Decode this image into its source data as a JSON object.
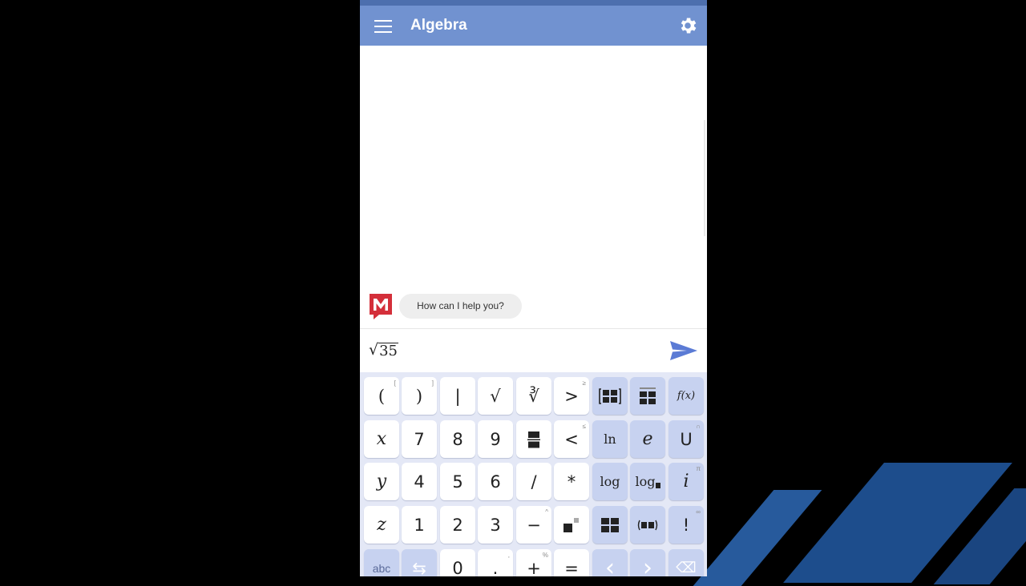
{
  "app": {
    "title": "Algebra"
  },
  "chat": {
    "bot_message": "How can I help you?",
    "bot_avatar_letter": "M"
  },
  "input": {
    "radical": "√",
    "radicand": "35"
  },
  "keyboard": {
    "rows": [
      [
        {
          "label": "(",
          "hint": "["
        },
        {
          "label": ")",
          "hint": "]"
        },
        {
          "label": "|",
          "hint": ""
        },
        {
          "label": "√",
          "hint": ""
        },
        {
          "label": "∛",
          "hint": ""
        },
        {
          "label": ">",
          "hint": "≥"
        },
        {
          "label": "matrix",
          "hint": ""
        },
        {
          "label": "system",
          "hint": ""
        },
        {
          "label": "f(x)",
          "hint": ""
        }
      ],
      [
        {
          "label": "x",
          "hint": ""
        },
        {
          "label": "7",
          "hint": ""
        },
        {
          "label": "8",
          "hint": ""
        },
        {
          "label": "9",
          "hint": ""
        },
        {
          "label": "fraction",
          "hint": ""
        },
        {
          "label": "<",
          "hint": "≤"
        },
        {
          "label": "ln",
          "hint": ""
        },
        {
          "label": "e",
          "hint": ""
        },
        {
          "label": "U",
          "hint": "∩"
        }
      ],
      [
        {
          "label": "y",
          "hint": ""
        },
        {
          "label": "4",
          "hint": ""
        },
        {
          "label": "5",
          "hint": ""
        },
        {
          "label": "6",
          "hint": ""
        },
        {
          "label": "/",
          "hint": ""
        },
        {
          "label": "*",
          "hint": ""
        },
        {
          "label": "log",
          "hint": ""
        },
        {
          "label": "log",
          "hint": ""
        },
        {
          "label": "i",
          "hint": "π"
        }
      ],
      [
        {
          "label": "z",
          "hint": ""
        },
        {
          "label": "1",
          "hint": ""
        },
        {
          "label": "2",
          "hint": ""
        },
        {
          "label": "3",
          "hint": ""
        },
        {
          "label": "−",
          "hint": "^"
        },
        {
          "label": "power",
          "hint": ""
        },
        {
          "label": "subscript",
          "hint": ""
        },
        {
          "label": "interval",
          "hint": ""
        },
        {
          "label": "!",
          "hint": "∞"
        }
      ],
      [
        {
          "label": "abc",
          "hint": ""
        },
        {
          "label": "⇆",
          "hint": ""
        },
        {
          "label": "0",
          "hint": ""
        },
        {
          "label": ".",
          "hint": ","
        },
        {
          "label": "+",
          "hint": "%"
        },
        {
          "label": "=",
          "hint": ""
        },
        {
          "label": "‹",
          "hint": ""
        },
        {
          "label": "›",
          "hint": ""
        },
        {
          "label": "⌫",
          "hint": ""
        }
      ]
    ]
  },
  "colors": {
    "appbar": "#7192d0",
    "keyboard_bg": "#e4e8f6",
    "accent": "#5b7bd5",
    "brand_red": "#d42f3a"
  }
}
